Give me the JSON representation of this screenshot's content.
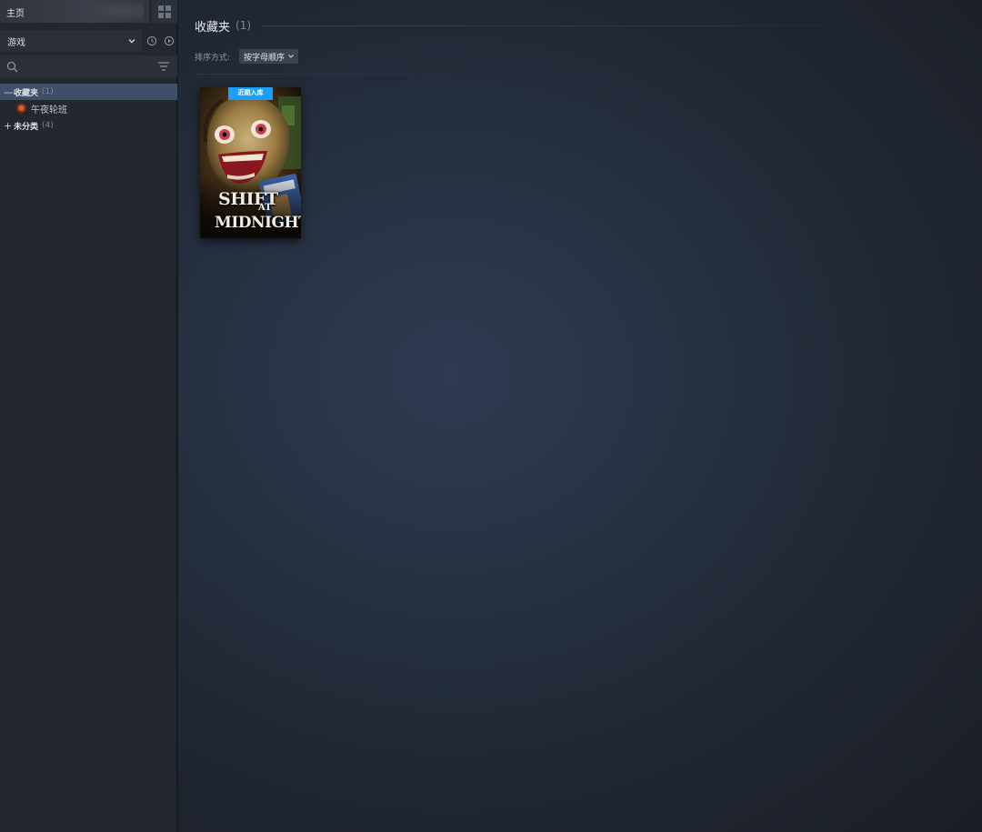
{
  "sidebar": {
    "home_label": "主页",
    "filter": {
      "selected": "游戏"
    },
    "search": {
      "value": "",
      "placeholder": ""
    },
    "tree": {
      "favorites": {
        "label": "收藏夹",
        "count": "(1)",
        "sign": "—"
      },
      "favorites_games": [
        {
          "name": "午夜轮班"
        }
      ],
      "uncategorized": {
        "label": "未分类",
        "count": "(4)",
        "sign": "+"
      }
    }
  },
  "main": {
    "collection": {
      "title": "收藏夹",
      "count": "(1)"
    },
    "sort": {
      "label": "排序方式:",
      "selected": "按字母顺序"
    },
    "games": [
      {
        "badge": "近期入库",
        "cover_line1": "SHIFT",
        "cover_line_at": "AT",
        "cover_line2": "MIDNIGHT"
      }
    ]
  },
  "colors": {
    "accent_badge": "#1a9fff",
    "selected_row": "#3f4f6a",
    "sidebar_bg": "#23272f"
  },
  "icons": {
    "grid": "grid-view-icon",
    "chevron": "chevron-down-icon",
    "recent": "clock-icon",
    "play": "play-circle-icon",
    "search": "search-icon",
    "filter": "filter-lines-icon"
  }
}
